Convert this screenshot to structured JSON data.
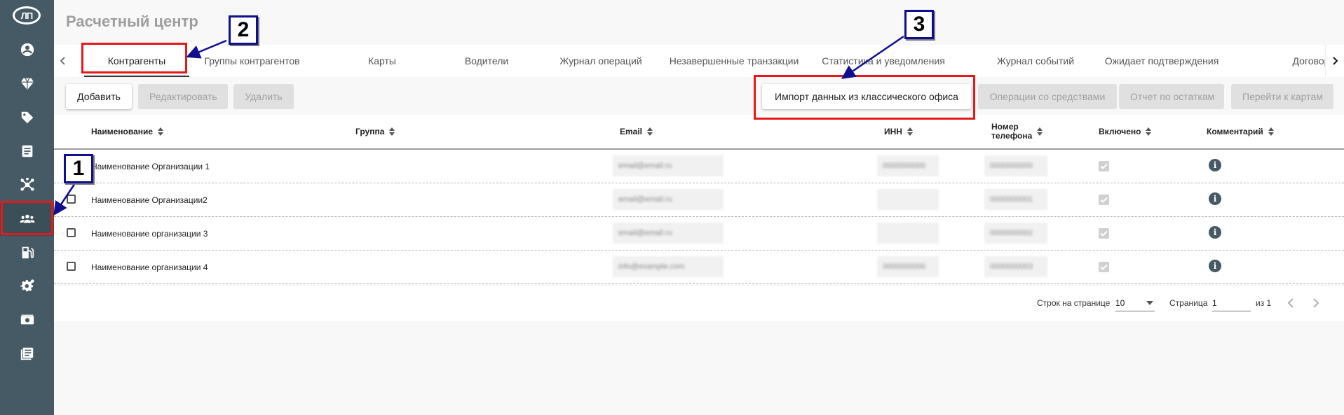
{
  "app": {
    "page_title": "Расчетный центр",
    "logo_text": "ЛП"
  },
  "sidebar": {
    "items": [
      {
        "icon": "user-icon"
      },
      {
        "icon": "diamond-icon"
      },
      {
        "icon": "tag-icon"
      },
      {
        "icon": "document-icon"
      },
      {
        "icon": "network-icon"
      },
      {
        "icon": "people-icon",
        "active": true
      },
      {
        "icon": "fuel-pump-icon"
      },
      {
        "icon": "gear-icon"
      },
      {
        "icon": "money-icon"
      },
      {
        "icon": "list-icon"
      }
    ]
  },
  "tabs": [
    {
      "label": "Контрагенты",
      "active": true
    },
    {
      "label": "Группы контрагентов"
    },
    {
      "label": "Карты"
    },
    {
      "label": "Водители"
    },
    {
      "label": "Журнал операций"
    },
    {
      "label": "Незавершенные транзакции"
    },
    {
      "label": "Статистика и уведомления"
    },
    {
      "label": "Журнал событий"
    },
    {
      "label": "Ожидает подтверждения"
    },
    {
      "label": "Договоры"
    }
  ],
  "toolbar": {
    "add": "Добавить",
    "edit": "Редактировать",
    "delete": "Удалить",
    "import": "Импорт данных из классического офиса",
    "operations": "Операции со средствами",
    "balance_report": "Отчет по остаткам",
    "go_to_cards": "Перейти к картам"
  },
  "table": {
    "columns": {
      "name": "Наименование",
      "group": "Группа",
      "email": "Email",
      "inn": "ИНН",
      "phone_line1": "Номер",
      "phone_line2": "телефона",
      "enabled": "Включено",
      "comment": "Комментарий"
    },
    "rows": [
      {
        "name": "Наименование Организации 1",
        "email": "email@email.ru",
        "inn": "0000000000",
        "phone": "0000000000"
      },
      {
        "name": "Наименование Организации2",
        "email": "email@email.ru",
        "inn": "",
        "phone": "0000000001"
      },
      {
        "name": "Наименование организации 3",
        "email": "email@email.ru",
        "inn": "",
        "phone": "0000000002"
      },
      {
        "name": "Наименование организации 4",
        "email": "info@example.com",
        "inn": "0000000000",
        "phone": "0000000003"
      }
    ]
  },
  "pager": {
    "rows_per_page_label": "Строк на странице",
    "rows_per_page_value": "10",
    "page_label": "Страница",
    "page_value": "1",
    "of_label": "из 1"
  },
  "annotations": {
    "badge_1": "1",
    "badge_2": "2",
    "badge_3": "3"
  },
  "colors": {
    "sidebar": "#455a64",
    "annotation_red": "#e81818",
    "annotation_blue": "#0f0f8f"
  }
}
